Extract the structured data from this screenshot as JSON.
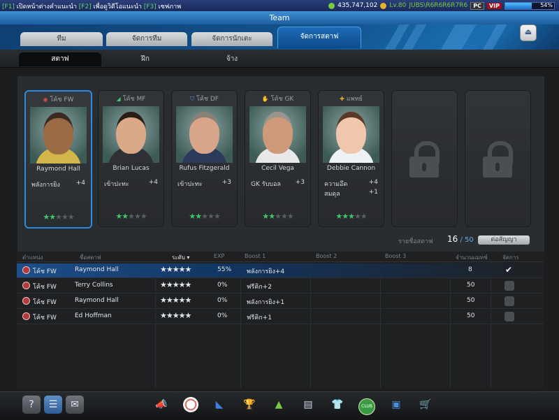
{
  "topbar": {
    "hint1_key": "[F1]",
    "hint1_text": " เปิดหน้าต่างคำแนะนำ ",
    "hint2_key": "[F2]",
    "hint2_text": " เพื่อดูวิดีโอแนะนำ ",
    "hint3_key": "[F3]",
    "hint3_text": " เซฟภาพ",
    "gp": "435,747,102",
    "level": "Lv.80",
    "username": "JUBS\\R6R6R6R7R6",
    "pc": "PC",
    "vip": "VIP",
    "exp_percent_label": "54%",
    "exp_fraction": 0.54
  },
  "window": {
    "title": "Team"
  },
  "tabs": [
    {
      "label": "ทีม"
    },
    {
      "label": "จัดการทีม"
    },
    {
      "label": "จัดการนักเตะ"
    },
    {
      "label": "จัดการสตาฟ"
    }
  ],
  "subtabs": [
    {
      "label": "สตาฟ"
    },
    {
      "label": "ฝึก"
    },
    {
      "label": "จ้าง"
    }
  ],
  "staff_cards": [
    {
      "role": "โค้ช FW",
      "role_icon": "whistle-icon",
      "name": "Raymond Hall",
      "stat1": "พลังการยิง",
      "val1": "+4",
      "stat2": "",
      "val2": "",
      "stars_on": 2,
      "stars_total": 5,
      "skin": "#9a6b45",
      "shirt": "#d2b64a",
      "hair": "#3a2a20"
    },
    {
      "role": "โค้ช MF",
      "role_icon": "boot-icon",
      "name": "Brian Lucas",
      "stat1": "เข้าปะทะ",
      "val1": "+4",
      "stat2": "",
      "val2": "",
      "stars_on": 2,
      "stars_total": 5,
      "skin": "#d9a989",
      "shirt": "#2f3136",
      "hair": "#2a1e16"
    },
    {
      "role": "โค้ช DF",
      "role_icon": "shield-icon",
      "name": "Rufus Fitzgerald",
      "stat1": "เข้าปะทะ",
      "val1": "+3",
      "stat2": "",
      "val2": "",
      "stars_on": 2,
      "stars_total": 5,
      "skin": "#d8a58b",
      "shirt": "#2b3a5a",
      "hair": "#8a8176"
    },
    {
      "role": "โค้ช GK",
      "role_icon": "glove-icon",
      "name": "Cecil Vega",
      "stat1": "GK รับบอล",
      "val1": "+3",
      "stat2": "",
      "val2": "",
      "stars_on": 2,
      "stars_total": 5,
      "skin": "#cf9a7a",
      "shirt": "#e8e8e8",
      "hair": "#9a948c"
    },
    {
      "role": "แพทย์",
      "role_icon": "medkit-icon",
      "name": "Debbie Cannon",
      "stat1": "ความอึด",
      "val1": "+4",
      "stat2": "สมดุล",
      "val2": "+1",
      "stars_on": 3,
      "stars_total": 5,
      "skin": "#f0c7ad",
      "shirt": "#eef2f4",
      "hair": "#5a3a24"
    }
  ],
  "staff_count": {
    "label": "รายชื่อสตาฟ",
    "current": "16",
    "sep": " / ",
    "max": "50"
  },
  "contract_button": "ต่อสัญญา",
  "table": {
    "headers": {
      "position": "ตำแหน่ง",
      "name": "ชื่อสตาฟ",
      "level": "ระดับ ▾",
      "exp": "EXP",
      "boost1": "Boost 1",
      "boost2": "Boost 2",
      "boost3": "Boost 3",
      "matches": "จำนวนแมทช์",
      "manage": "จัดการ"
    },
    "rows": [
      {
        "position": "โค้ช FW",
        "name": "Raymond Hall",
        "stars_on": 2,
        "exp": "55%",
        "boost1": "พลังการยิง+4",
        "matches": "8",
        "checked": true
      },
      {
        "position": "โค้ช FW",
        "name": "Terry Collins",
        "stars_on": 1,
        "exp": "0%",
        "boost1": "ฟรีคิก+2",
        "matches": "50",
        "checked": false
      },
      {
        "position": "โค้ช FW",
        "name": "Raymond Hall",
        "stars_on": 1,
        "exp": "0%",
        "boost1": "พลังการยิง+1",
        "matches": "50",
        "checked": false
      },
      {
        "position": "โค้ช FW",
        "name": "Ed Hoffman",
        "stars_on": 1,
        "exp": "0%",
        "boost1": "ฟรีคิก+1",
        "matches": "50",
        "checked": false
      }
    ]
  },
  "bottom_icons": [
    "help-icon",
    "notes-icon",
    "mail-icon",
    "whistle-icon",
    "ball-icon",
    "boots-icon",
    "trophy-icon",
    "league-icon",
    "tactics-icon",
    "jersey-icon",
    "club-icon",
    "card-icon",
    "shop-cart-icon"
  ]
}
